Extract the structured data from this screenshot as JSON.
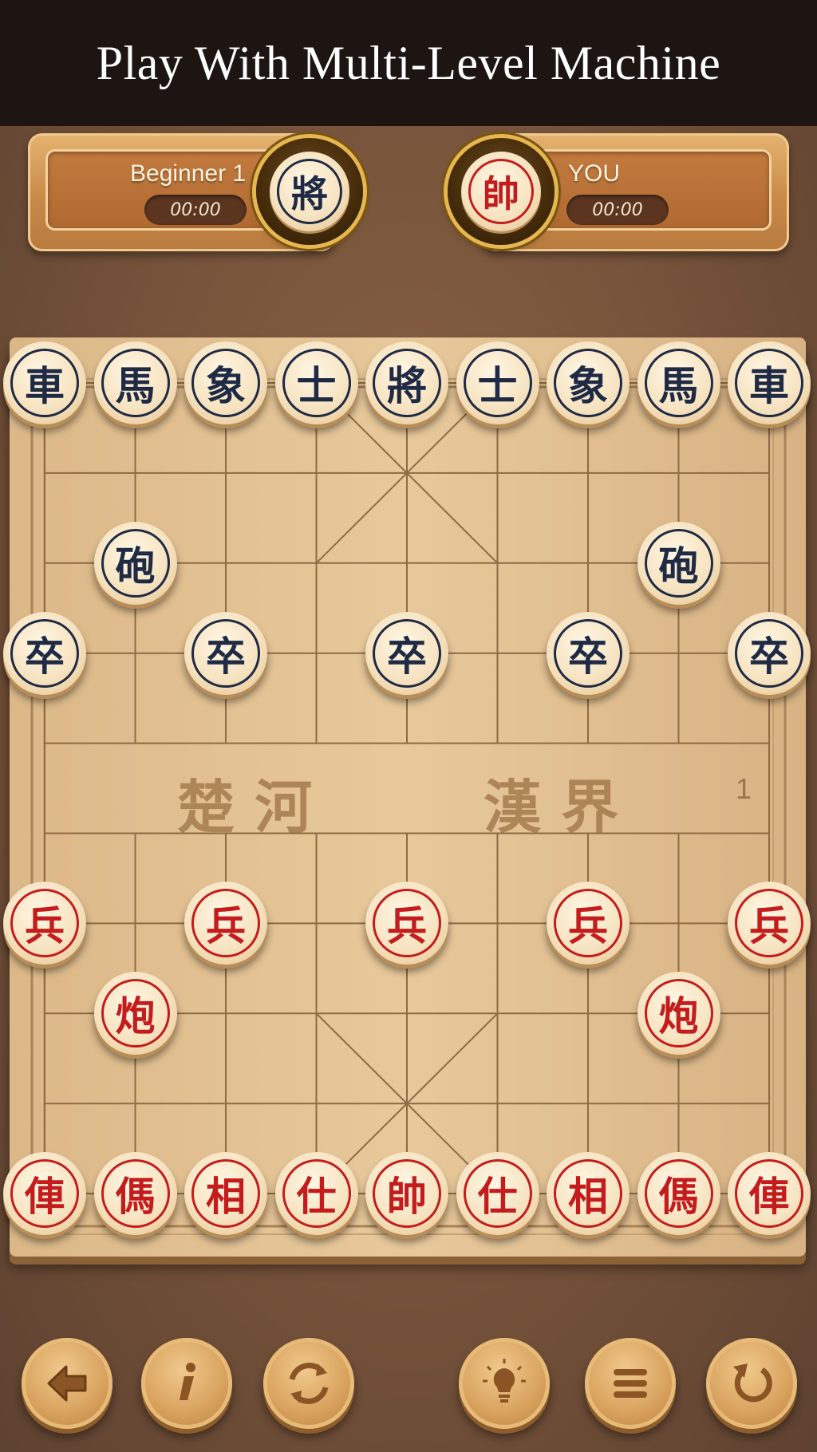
{
  "banner": {
    "title": "Play With Multi-Level Machine"
  },
  "opponent": {
    "name": "Beginner 1",
    "timer": "00:00",
    "avatar_char": "將"
  },
  "player": {
    "name": "YOU",
    "timer": "00:00",
    "avatar_char": "帥"
  },
  "board": {
    "river_left": "楚 河",
    "river_right": "漢 界",
    "move_count": "1",
    "pieces": [
      {
        "char": "車",
        "side": "black",
        "col": 0,
        "row": 0
      },
      {
        "char": "馬",
        "side": "black",
        "col": 1,
        "row": 0
      },
      {
        "char": "象",
        "side": "black",
        "col": 2,
        "row": 0
      },
      {
        "char": "士",
        "side": "black",
        "col": 3,
        "row": 0
      },
      {
        "char": "將",
        "side": "black",
        "col": 4,
        "row": 0
      },
      {
        "char": "士",
        "side": "black",
        "col": 5,
        "row": 0
      },
      {
        "char": "象",
        "side": "black",
        "col": 6,
        "row": 0
      },
      {
        "char": "馬",
        "side": "black",
        "col": 7,
        "row": 0
      },
      {
        "char": "車",
        "side": "black",
        "col": 8,
        "row": 0
      },
      {
        "char": "砲",
        "side": "black",
        "col": 1,
        "row": 2
      },
      {
        "char": "砲",
        "side": "black",
        "col": 7,
        "row": 2
      },
      {
        "char": "卒",
        "side": "black",
        "col": 0,
        "row": 3
      },
      {
        "char": "卒",
        "side": "black",
        "col": 2,
        "row": 3
      },
      {
        "char": "卒",
        "side": "black",
        "col": 4,
        "row": 3
      },
      {
        "char": "卒",
        "side": "black",
        "col": 6,
        "row": 3
      },
      {
        "char": "卒",
        "side": "black",
        "col": 8,
        "row": 3
      },
      {
        "char": "兵",
        "side": "red",
        "col": 0,
        "row": 6
      },
      {
        "char": "兵",
        "side": "red",
        "col": 2,
        "row": 6
      },
      {
        "char": "兵",
        "side": "red",
        "col": 4,
        "row": 6
      },
      {
        "char": "兵",
        "side": "red",
        "col": 6,
        "row": 6
      },
      {
        "char": "兵",
        "side": "red",
        "col": 8,
        "row": 6
      },
      {
        "char": "炮",
        "side": "red",
        "col": 1,
        "row": 7
      },
      {
        "char": "炮",
        "side": "red",
        "col": 7,
        "row": 7
      },
      {
        "char": "俥",
        "side": "red",
        "col": 0,
        "row": 9
      },
      {
        "char": "傌",
        "side": "red",
        "col": 1,
        "row": 9
      },
      {
        "char": "相",
        "side": "red",
        "col": 2,
        "row": 9
      },
      {
        "char": "仕",
        "side": "red",
        "col": 3,
        "row": 9
      },
      {
        "char": "帥",
        "side": "red",
        "col": 4,
        "row": 9
      },
      {
        "char": "仕",
        "side": "red",
        "col": 5,
        "row": 9
      },
      {
        "char": "相",
        "side": "red",
        "col": 6,
        "row": 9
      },
      {
        "char": "傌",
        "side": "red",
        "col": 7,
        "row": 9
      },
      {
        "char": "俥",
        "side": "red",
        "col": 8,
        "row": 9
      }
    ]
  },
  "toolbar": {
    "buttons": [
      {
        "name": "back-button",
        "icon": "arrow-left-icon"
      },
      {
        "name": "info-button",
        "icon": "info-icon"
      },
      {
        "name": "swap-sides-button",
        "icon": "refresh-icon"
      },
      {
        "name": "hint-button",
        "icon": "lightbulb-icon"
      },
      {
        "name": "menu-button",
        "icon": "menu-icon"
      },
      {
        "name": "undo-button",
        "icon": "undo-icon"
      }
    ]
  },
  "colors": {
    "black_piece": "#1f2a44",
    "red_piece": "#c41c1c",
    "banner_bg": "#1c1512"
  }
}
